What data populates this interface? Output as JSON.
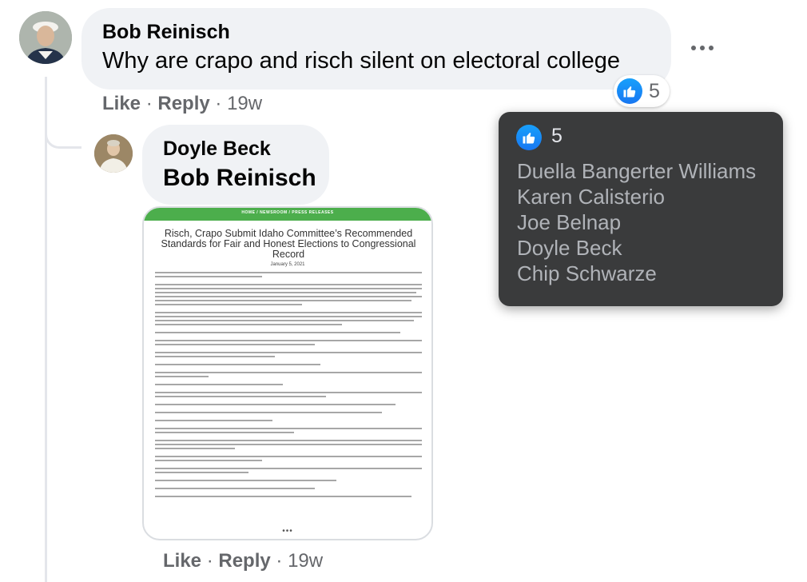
{
  "comment": {
    "author": "Bob Reinisch",
    "text": "Why are crapo and risch silent on electoral college",
    "reaction_count": "5",
    "actions": {
      "like": "Like",
      "separator": "·",
      "reply": "Reply",
      "time": "19w"
    }
  },
  "reply": {
    "author": "Doyle Beck",
    "mention": "Bob Reinisch",
    "actions": {
      "like": "Like",
      "separator": "·",
      "reply": "Reply",
      "time": "19w"
    },
    "attachment": {
      "breadcrumb": "HOME / NEWSROOM / PRESS RELEASES",
      "title": "Risch, Crapo Submit Idaho Committee’s Recommended Standards for Fair and Honest Elections to Congressional Record",
      "date": "January 5, 2021",
      "more": "•••"
    }
  },
  "tooltip": {
    "count": "5",
    "names": [
      "Duella Bangerter Williams",
      "Karen Calisterio",
      "Joe Belnap",
      "Doyle Beck",
      "Chip Schwarze"
    ]
  },
  "icons": {
    "like": "like-thumb-icon",
    "more": "more-options-icon"
  },
  "colors": {
    "like_blue": "#1877f2",
    "bubble_bg": "#f0f2f5",
    "tooltip_bg": "#3a3b3c",
    "meta_gray": "#65676b"
  }
}
